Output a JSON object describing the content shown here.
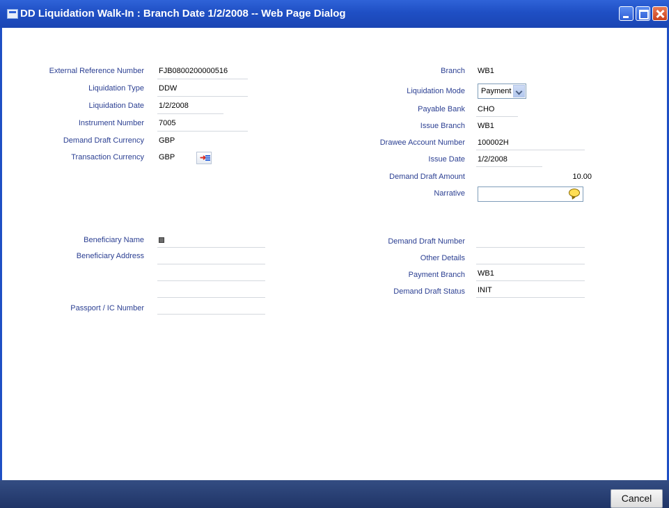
{
  "window": {
    "title": "DD Liquidation Walk-In : Branch Date 1/2/2008 -- Web Page Dialog"
  },
  "left": {
    "external_reference_number": {
      "label": "External Reference Number",
      "value": "FJB0800200000516"
    },
    "liquidation_type": {
      "label": "Liquidation Type",
      "value": "DDW"
    },
    "liquidation_date": {
      "label": "Liquidation Date",
      "value": "1/2/2008"
    },
    "instrument_number": {
      "label": "Instrument Number",
      "value": "7005"
    },
    "demand_draft_currency": {
      "label": "Demand Draft Currency",
      "value": "GBP"
    },
    "transaction_currency": {
      "label": "Transaction Currency",
      "value": "GBP"
    },
    "beneficiary_name": {
      "label": "Beneficiary Name",
      "value": ""
    },
    "beneficiary_address": {
      "label": "Beneficiary Address",
      "lines": [
        "",
        "",
        ""
      ]
    },
    "passport_ic_number": {
      "label": "Passport / IC Number",
      "value": ""
    }
  },
  "right": {
    "branch": {
      "label": "Branch",
      "value": "WB1"
    },
    "liquidation_mode": {
      "label": "Liquidation Mode",
      "value": "Payment"
    },
    "payable_bank": {
      "label": "Payable Bank",
      "value": "CHO"
    },
    "issue_branch": {
      "label": "Issue Branch",
      "value": "WB1"
    },
    "drawee_account_number": {
      "label": "Drawee Account Number",
      "value": "100002H"
    },
    "issue_date": {
      "label": "Issue Date",
      "value": "1/2/2008"
    },
    "demand_draft_amount": {
      "label": "Demand Draft Amount",
      "value": "10.00"
    },
    "narrative": {
      "label": "Narrative",
      "value": ""
    },
    "demand_draft_number": {
      "label": "Demand Draft Number",
      "value": ""
    },
    "other_details": {
      "label": "Other Details",
      "value": ""
    },
    "payment_branch": {
      "label": "Payment Branch",
      "value": "WB1"
    },
    "demand_draft_status": {
      "label": "Demand Draft Status",
      "value": "INIT"
    }
  },
  "footer": {
    "cancel_label": "Cancel"
  },
  "colors": {
    "titlebar": "#1f4fc4",
    "label": "#2b3f92",
    "footer": "#24396f"
  }
}
